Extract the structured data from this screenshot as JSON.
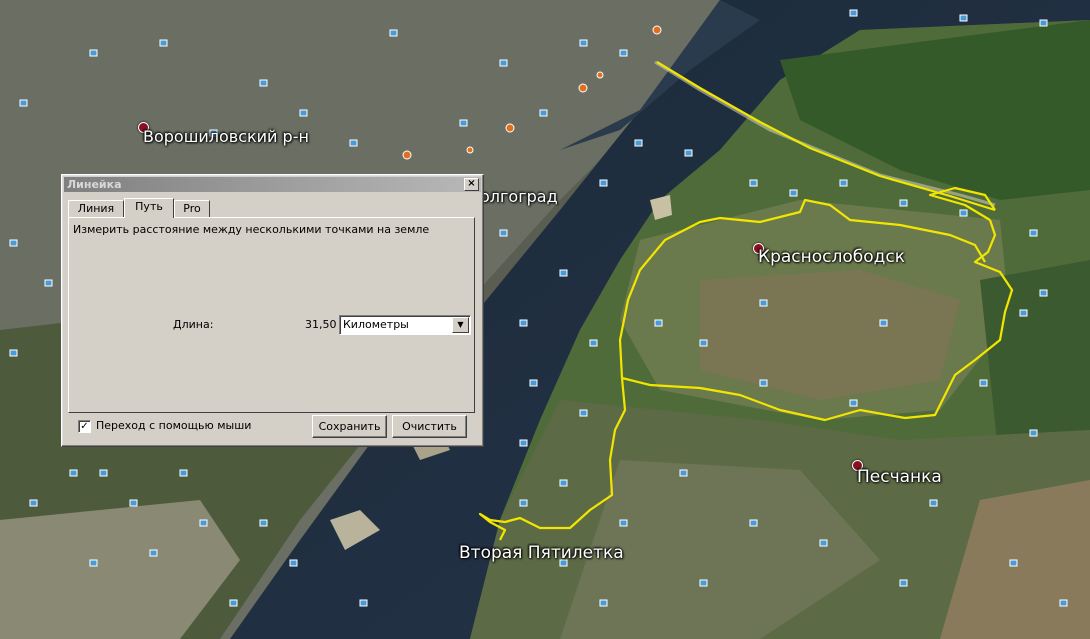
{
  "map": {
    "places": [
      {
        "name": "Ворошиловский р-н",
        "kind": "district"
      },
      {
        "name": "олгоград",
        "kind": "city"
      },
      {
        "name": "Краснослободск",
        "kind": "town"
      },
      {
        "name": "Песчанка",
        "kind": "village"
      },
      {
        "name": "Вторая Пятилетка",
        "kind": "village"
      }
    ],
    "path_color": "#f2e600",
    "poi_icon": "photo-marker-icon"
  },
  "ruler": {
    "title": "Линейка",
    "close": "×",
    "tabs": [
      {
        "label": "Линия",
        "active": false
      },
      {
        "label": "Путь",
        "active": true
      },
      {
        "label": "Pro",
        "active": false
      }
    ],
    "description": "Измерить расстояние между несколькими точками на земле",
    "length_label": "Длина:",
    "length_value": "31,50",
    "units_selected": "Километры",
    "mouse_nav_label": "Переход с помощью мыши",
    "mouse_nav_checked": true,
    "check_mark": "✓",
    "save_label": "Сохранить",
    "clear_label": "Очистить"
  }
}
